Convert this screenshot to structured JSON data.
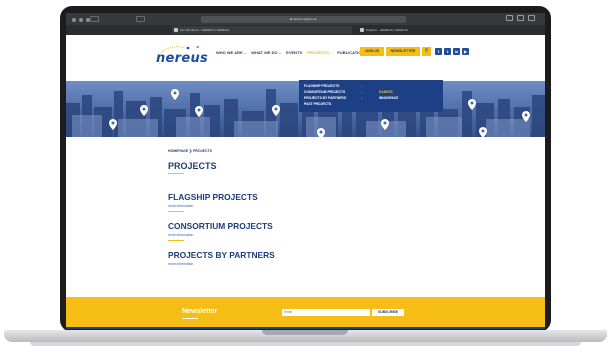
{
  "browser": {
    "url": "■ nereus-regions.eu",
    "tabs": [
      {
        "label": "Our Members – NEREUS | NEREUS"
      },
      {
        "label": "Projects – NEREUS | NEREUS"
      }
    ]
  },
  "header": {
    "logo_text": "nereus",
    "nav": [
      {
        "label": "WHO WE ARE",
        "dropdown": true
      },
      {
        "label": "WHAT WE DO",
        "dropdown": true
      },
      {
        "label": "EVENTS",
        "dropdown": false
      },
      {
        "label": "PROJECTS",
        "dropdown": true,
        "active": true
      },
      {
        "label": "PUBLICATIONS",
        "dropdown": false
      }
    ],
    "join_label": "JOIN US",
    "newsletter_label": "NEWSLETTER",
    "search_icon": "search-icon",
    "social_icons": [
      "facebook-icon",
      "twitter-icon",
      "linkedin-icon",
      "youtube-icon"
    ]
  },
  "dropdown": {
    "items": [
      {
        "label": "FLAGSHIP PROJECTS"
      },
      {
        "label": "CONSORTIUM PROJECTS"
      },
      {
        "label": "PROJECTS BY PARTNERS"
      },
      {
        "label": "PAST PROJECTS"
      }
    ],
    "sub_items": [
      {
        "label": "DANESS"
      },
      {
        "label": "INNOSPACE"
      }
    ]
  },
  "breadcrumb": {
    "home": "HOMEPAGE",
    "separator": "❯",
    "current": "PROJECTS"
  },
  "page_title": "PROJECTS",
  "sections": [
    {
      "title": "FLAGSHIP PROJECTS",
      "link": "more information"
    },
    {
      "title": "CONSORTIUM PROJECTS",
      "link": "more information"
    },
    {
      "title": "PROJECTS BY PARTNERS",
      "link": "more information"
    }
  ],
  "newsletter": {
    "title": "Newsletter",
    "email_placeholder": "Email",
    "subscribe_label": "SUBSCRIBE"
  },
  "colors": {
    "brand_blue": "#1e3d78",
    "accent_yellow": "#f6bd16",
    "dropdown_blue": "#1d3f86"
  }
}
